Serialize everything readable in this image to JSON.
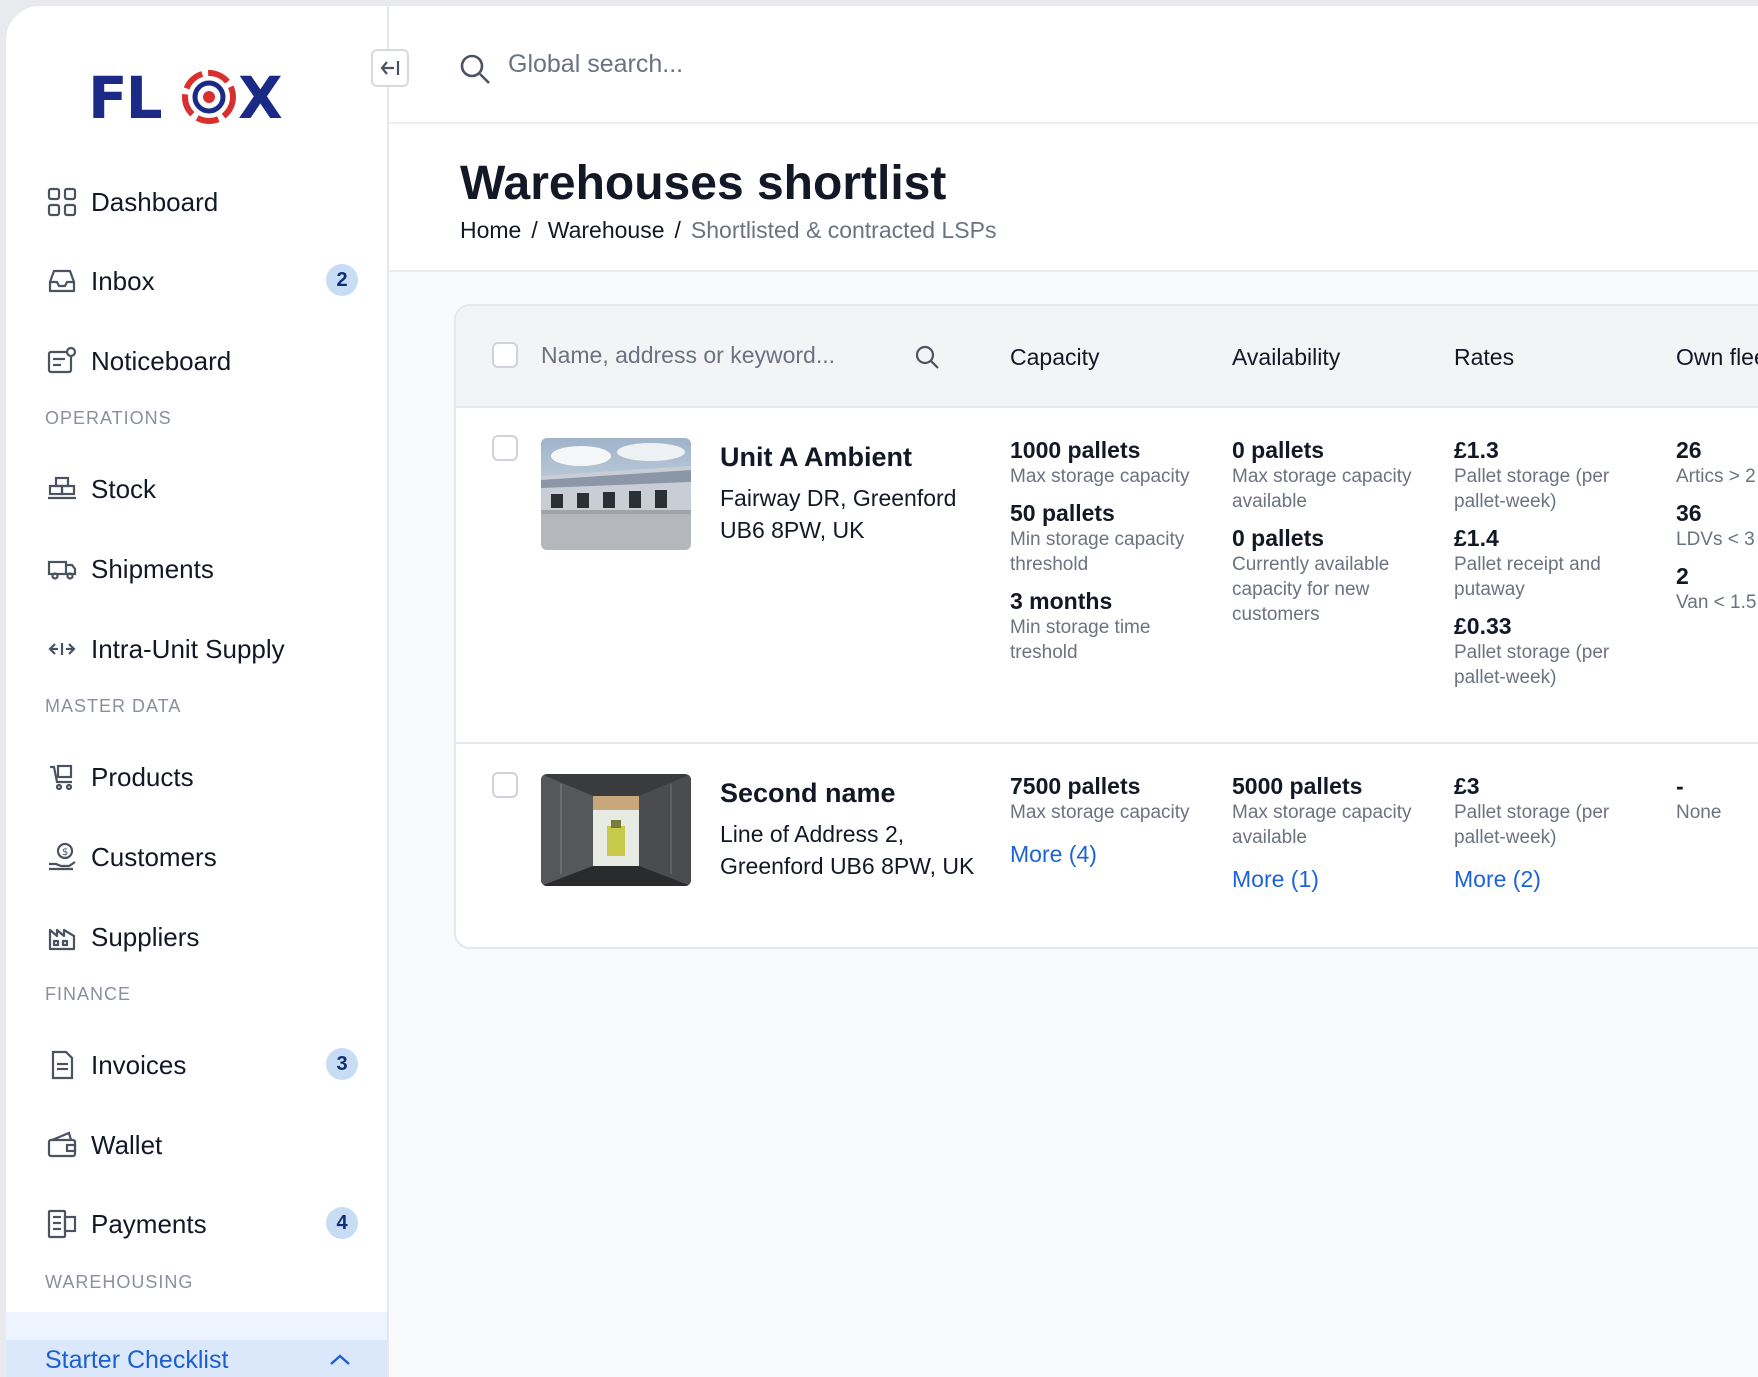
{
  "brand": {
    "logo_text": "FLOX",
    "accent": "#1b2a86",
    "ring": "#d8302f"
  },
  "topbar": {
    "search_placeholder": "Global search..."
  },
  "sidebar": {
    "items": [
      {
        "label": "Dashboard",
        "icon": "grid-icon"
      },
      {
        "label": "Inbox",
        "icon": "inbox-icon",
        "badge": "2"
      },
      {
        "label": "Noticeboard",
        "icon": "noticeboard-icon"
      },
      {
        "label": "Stock",
        "icon": "stock-icon"
      },
      {
        "label": "Shipments",
        "icon": "truck-icon"
      },
      {
        "label": "Intra-Unit Supply",
        "icon": "transfer-icon"
      },
      {
        "label": "Products",
        "icon": "cart-icon"
      },
      {
        "label": "Customers",
        "icon": "customers-icon"
      },
      {
        "label": "Suppliers",
        "icon": "factory-icon"
      },
      {
        "label": "Invoices",
        "icon": "invoice-icon",
        "badge": "3"
      },
      {
        "label": "Wallet",
        "icon": "wallet-icon"
      },
      {
        "label": "Payments",
        "icon": "payments-icon",
        "badge": "4"
      }
    ],
    "sections": [
      "OPERATIONS",
      "MASTER DATA",
      "FINANCE",
      "WAREHOUSING"
    ],
    "starter_checklist": "Starter Checklist"
  },
  "header": {
    "title": "Warehouses shortlist",
    "breadcrumb": [
      "Home",
      "Warehouse",
      "Shortlisted & contracted LSPs"
    ],
    "separator": "/"
  },
  "table": {
    "search_placeholder": "Name, address or keyword...",
    "columns": [
      "Capacity",
      "Availability",
      "Rates",
      "Own flee"
    ],
    "rows": [
      {
        "name": "Unit A Ambient",
        "address": "Fairway DR, Greenford UB6 8PW, UK",
        "capacity": [
          {
            "value": "1000 pallets",
            "desc": "Max storage capacity"
          },
          {
            "value": "50 pallets",
            "desc": "Min storage capacity threshold"
          },
          {
            "value": "3 months",
            "desc": "Min storage time treshold"
          }
        ],
        "availability": [
          {
            "value": "0 pallets",
            "desc": "Max storage capacity available"
          },
          {
            "value": "0 pallets",
            "desc": "Currently available capacity for new customers"
          }
        ],
        "rates": [
          {
            "value": "£1.3",
            "desc": "Pallet storage (per pallet-week)"
          },
          {
            "value": "£1.4",
            "desc": "Pallet receipt and putaway"
          },
          {
            "value": "£0.33",
            "desc": "Pallet storage (per pallet-week)"
          }
        ],
        "fleet": [
          {
            "value": "26",
            "desc": "Artics > 2"
          },
          {
            "value": "36",
            "desc": "LDVs < 3"
          },
          {
            "value": "2",
            "desc": "Van < 1.5"
          }
        ]
      },
      {
        "name": "Second name",
        "address": "Line of Address 2, Greenford UB6 8PW, UK",
        "capacity": [
          {
            "value": "7500 pallets",
            "desc": "Max storage capacity"
          }
        ],
        "capacity_more": "More (4)",
        "availability": [
          {
            "value": "5000 pallets",
            "desc": "Max storage capacity available"
          }
        ],
        "availability_more": "More (1)",
        "rates": [
          {
            "value": "£3",
            "desc": "Pallet storage (per pallet-week)"
          }
        ],
        "rates_more": "More (2)",
        "fleet": [
          {
            "value": "-",
            "desc": "None"
          }
        ]
      }
    ]
  }
}
